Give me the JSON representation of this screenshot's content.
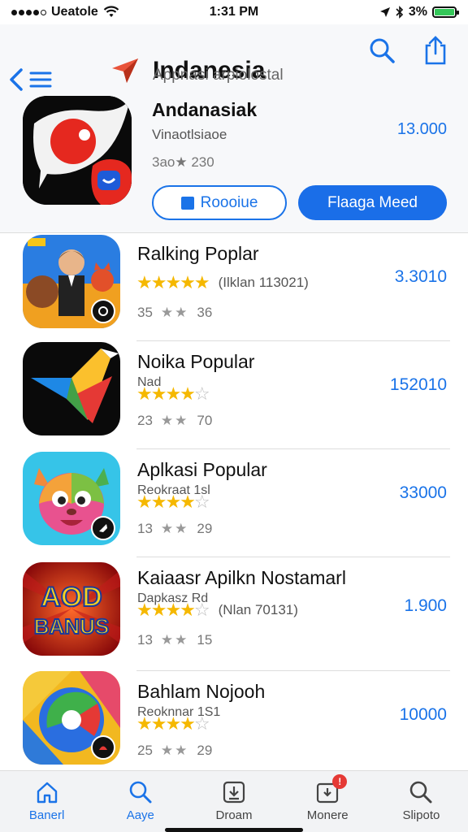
{
  "status": {
    "carrier": "Ueatole",
    "time": "1:31 PM",
    "battery": "3%"
  },
  "header": {
    "title": "Indanesia",
    "subtitle": "Appnasi arpiolostal",
    "back_icon": "chevron-left-icon",
    "menu_icon": "list-icon",
    "logo_icon": "location-arrow-icon",
    "search_icon": "search-icon",
    "share_icon": "share-icon"
  },
  "featured": {
    "name": "Andanasiak",
    "developer": "Vinaotlsiaoe",
    "rating_line": "3ao★ 230",
    "price": "13.000",
    "secondary_button": "Roooiue",
    "primary_button": "Flaaga Meed"
  },
  "apps": [
    {
      "name": "Ralking Poplar",
      "subtitle": "",
      "stars": 5,
      "note": "(Ilklan 113021)",
      "count_left": "35",
      "count_right": "36",
      "price": "3.3010"
    },
    {
      "name": "Noika Popular",
      "subtitle": "Nad",
      "stars": 4,
      "note": "",
      "count_left": "23",
      "count_right": "70",
      "price": "152010"
    },
    {
      "name": "Aplkasi Popular",
      "subtitle": "Reokraat 1sl",
      "stars": 4,
      "note": "",
      "count_left": "13",
      "count_right": "29",
      "price": "33000"
    },
    {
      "name": "Kaiaasr Apilkn Nostamarl",
      "subtitle": "Dapkasz Rd",
      "stars": 4,
      "note": "(Nlan 70131)",
      "count_left": "13",
      "count_right": "15",
      "price": "1.900",
      "icon_text_1": "AOD",
      "icon_text_2": "BANUS"
    },
    {
      "name": "Bahlam Nojooh",
      "subtitle": "Reoknnar 1S1",
      "stars": 4,
      "note": "",
      "count_left": "25",
      "count_right": "29",
      "price": "10000"
    }
  ],
  "tabs": [
    {
      "label": "Banerl",
      "icon": "home-icon",
      "active": true
    },
    {
      "label": "Aaye",
      "icon": "search-icon",
      "active": true
    },
    {
      "label": "Droam",
      "icon": "download-box-icon",
      "active": false
    },
    {
      "label": "Monere",
      "icon": "updates-icon",
      "active": false,
      "badge": "!"
    },
    {
      "label": "Slipoto",
      "icon": "search-icon",
      "active": false
    }
  ],
  "colors": {
    "accent": "#1a73e8",
    "star": "#f5b800",
    "battery": "#34c759"
  }
}
